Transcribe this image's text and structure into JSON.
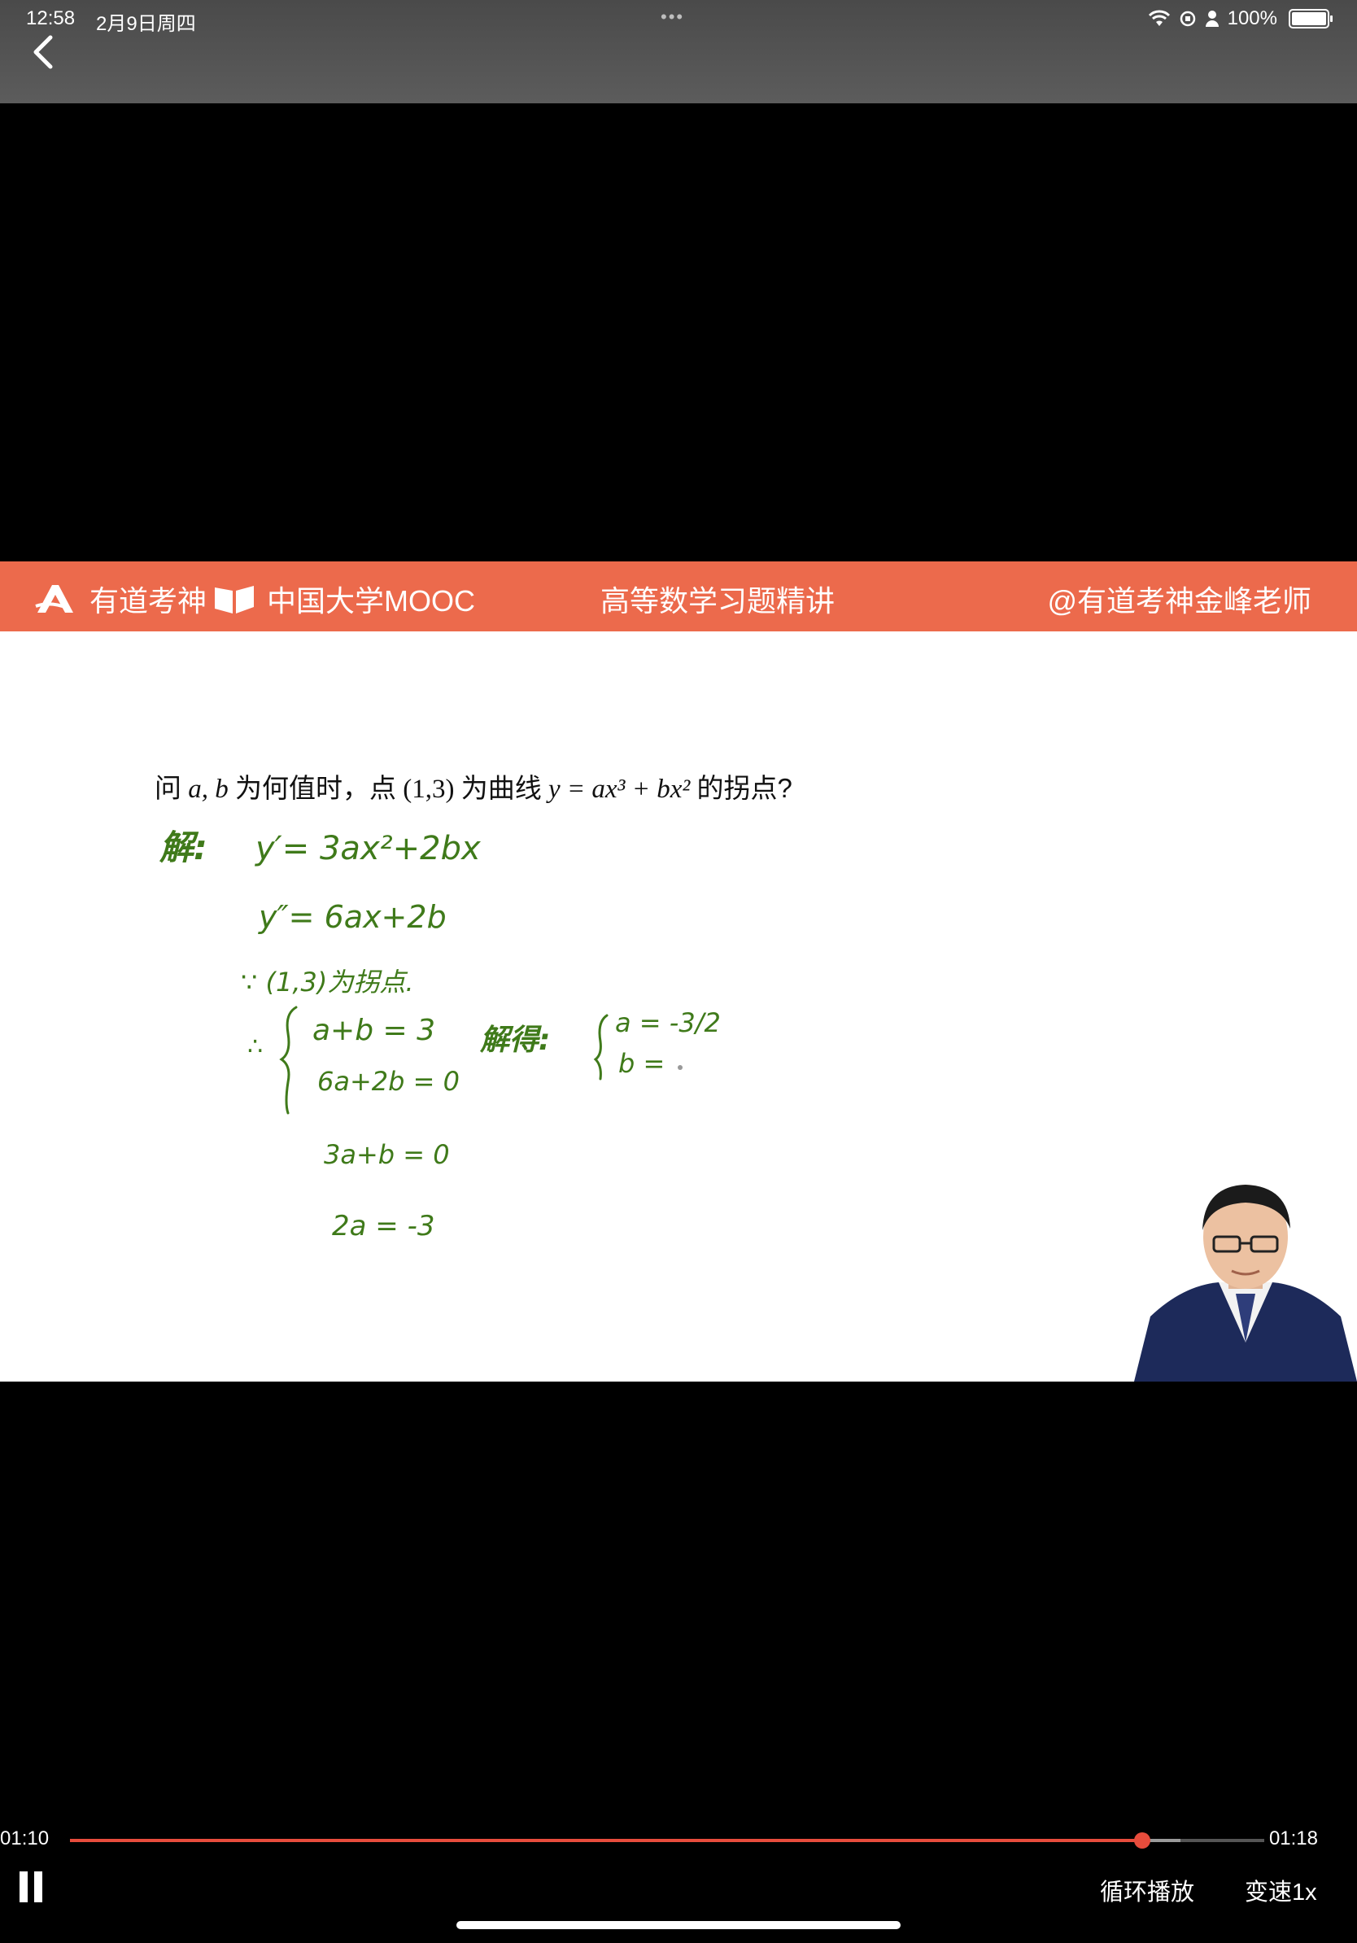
{
  "status_bar": {
    "time": "12:58",
    "date": "2月9日周四",
    "dots": "•••",
    "battery": "100%"
  },
  "banner": {
    "brand1": "有道考神",
    "brand2": "中国大学MOOC",
    "title": "高等数学习题精讲",
    "handle": "@有道考神金峰老师",
    "color": "#ec6a4c"
  },
  "question": {
    "prefix": "问",
    "vars": "a, b",
    "text1": "为何值时，点",
    "point": "(1,3)",
    "text2": "为曲线",
    "formula": "y = ax³ + bx²",
    "text3": "的拐点?"
  },
  "handwriting": {
    "label": "解:",
    "line1": "y′= 3ax²+2bx",
    "line2": "y″= 6ax+2b",
    "line3": "∵ (1,3)为拐点.",
    "line4a": "a+b = 3",
    "line4b": "6a+2b = 0",
    "line5": "3a+b = 0",
    "line6": "2a = -3",
    "solve_label": "解得:",
    "result_a": "a = -3/2",
    "result_b": "b =",
    "ink_color": "#3f7a1a"
  },
  "player": {
    "current_time": "01:10",
    "total_time": "01:18",
    "progress": 0.8975,
    "buffered": 0.93,
    "loop_label": "循环播放",
    "speed_label": "变速1x",
    "accent": "#e74c3c"
  }
}
